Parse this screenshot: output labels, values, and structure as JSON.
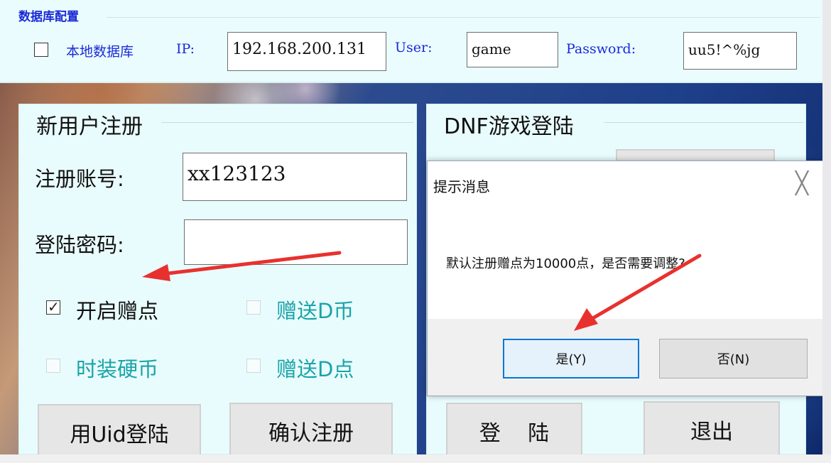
{
  "db_config": {
    "title": "数据库配置",
    "local_db_label": "本地数据库",
    "local_db_checked": false,
    "ip_label": "IP:",
    "ip_value": "192.168.200.131",
    "user_label": "User:",
    "user_value": "game",
    "password_label": "Password:",
    "password_value": "uu5!^%jg"
  },
  "register": {
    "title": "新用户注册",
    "account_label": "注册账号:",
    "account_value": "xx123123",
    "password_label": "登陆密码:",
    "password_value": "",
    "enable_bonus_label": "开启赠点",
    "enable_bonus_checked": true,
    "give_dcoin_label": "赠送D币",
    "fashion_coin_label": "时装硬币",
    "give_dpoint_label": "赠送D点",
    "uid_login_button": "用Uid登陆",
    "confirm_register_button": "确认注册"
  },
  "login": {
    "title": "DNF游戏登陆",
    "login_button": "登    陆",
    "exit_button": "退出"
  },
  "dialog": {
    "title": "提示消息",
    "message": "默认注册赠点为10000点，是否需要调整?",
    "yes_button": "是(Y)",
    "no_button": "否(N)",
    "close_glyph": "╳"
  },
  "colors": {
    "accent_blue": "#1a2ad8",
    "teal_disabled": "#1aa3a8",
    "arrow_red": "#e8312e",
    "dialog_default_border": "#0078d7"
  }
}
